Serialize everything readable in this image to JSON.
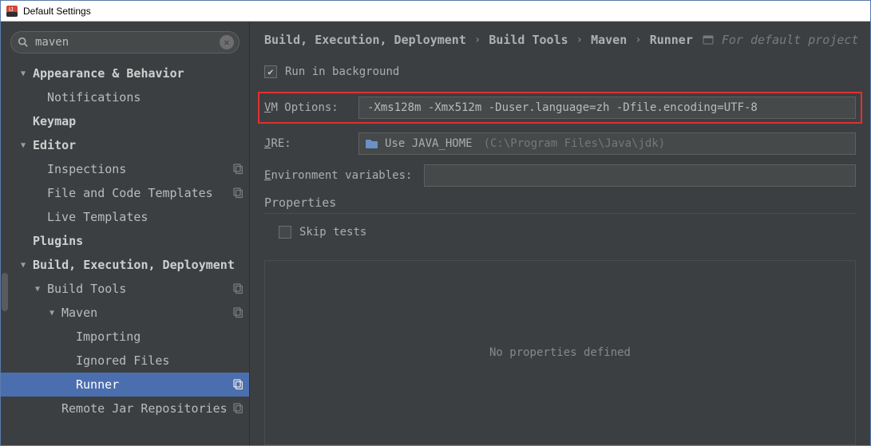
{
  "window": {
    "title": "Default Settings"
  },
  "search": {
    "value": "maven"
  },
  "sidebar": {
    "items": [
      {
        "label": "Appearance & Behavior",
        "depth": 0,
        "arrow": "down",
        "bold": true
      },
      {
        "label": "Notifications",
        "depth": 1
      },
      {
        "label": "Keymap",
        "depth": 0,
        "bold": true
      },
      {
        "label": "Editor",
        "depth": 0,
        "arrow": "down",
        "bold": true
      },
      {
        "label": "Inspections",
        "depth": 1,
        "copy": true
      },
      {
        "label": "File and Code Templates",
        "depth": 1,
        "copy": true
      },
      {
        "label": "Live Templates",
        "depth": 1
      },
      {
        "label": "Plugins",
        "depth": 0,
        "bold": true
      },
      {
        "label": "Build, Execution, Deployment",
        "depth": 0,
        "arrow": "down",
        "bold": true
      },
      {
        "label": "Build Tools",
        "depth": 1,
        "arrow": "down",
        "copy": true
      },
      {
        "label": "Maven",
        "depth": 2,
        "arrow": "down",
        "copy": true
      },
      {
        "label": "Importing",
        "depth": 3
      },
      {
        "label": "Ignored Files",
        "depth": 3
      },
      {
        "label": "Runner",
        "depth": 3,
        "selected": true,
        "copy": true
      },
      {
        "label": "Remote Jar Repositories",
        "depth": 2,
        "copy": true
      }
    ]
  },
  "breadcrumb": {
    "parts": [
      "Build, Execution, Deployment",
      "Build Tools",
      "Maven",
      "Runner"
    ],
    "suffix": "For default project"
  },
  "form": {
    "run_bg_label_prefix": "Run in ",
    "run_bg_label_u": "b",
    "run_bg_label_suffix": "ackground",
    "run_bg_checked": true,
    "vm_label_u": "V",
    "vm_label_rest": "M Options:",
    "vm_value": "-Xms128m -Xmx512m -Duser.language=zh -Dfile.encoding=UTF-8",
    "jre_label_u": "J",
    "jre_label_rest": "RE:",
    "jre_text": "Use JAVA_HOME",
    "jre_hint": "(C:\\Program Files\\Java\\jdk)",
    "env_label_u": "E",
    "env_label_rest": "nvironment variables:",
    "env_value": "",
    "props_title": "Properties",
    "skip_label_prefix": "Skip ",
    "skip_label_u": "t",
    "skip_label_suffix": "ests",
    "skip_checked": false,
    "props_placeholder": "No properties defined"
  }
}
